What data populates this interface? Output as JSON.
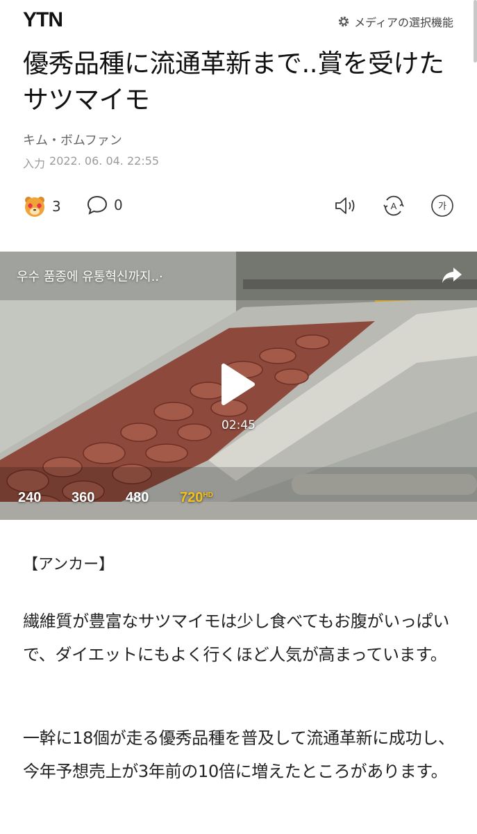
{
  "header": {
    "logo": "YTN",
    "media_settings_label": "メディアの選択機能",
    "media_settings_icon": "gear-icon"
  },
  "article": {
    "title": "優秀品種に流通革新まで..賞を受けたサツマイモ",
    "author": "キム・ボムファン",
    "input_label": "入力",
    "date": "2022. 06. 04. 22:55"
  },
  "actions": {
    "reaction_count": "3",
    "comment_count": "0",
    "reaction_icon": "heart-eyes-emoji-icon",
    "comment_icon": "speech-bubble-icon",
    "tools": [
      "speaker-icon",
      "translate-icon",
      "font-size-icon"
    ],
    "font_size_label": "가",
    "translate_label": "A"
  },
  "video": {
    "title": "우수 품종에 유통혁신까지..·",
    "duration": "02:45",
    "qualities": [
      {
        "label": "240",
        "active": false
      },
      {
        "label": "360",
        "active": false
      },
      {
        "label": "480",
        "active": false
      },
      {
        "label": "720",
        "active": true,
        "badge": "HD"
      }
    ],
    "active_color": "#f2c21b"
  },
  "body": {
    "anchor": "【アンカー】",
    "paragraphs": [
      "繊維質が豊富なサツマイモは少し食べてもお腹がいっぱいで、ダイエットにもよく行くほど人気が高まっています。",
      "一幹に18個が走る優秀品種を普及して流通革新に成功し、今年予想売上が3年前の10倍に増えたところがあります。"
    ]
  }
}
